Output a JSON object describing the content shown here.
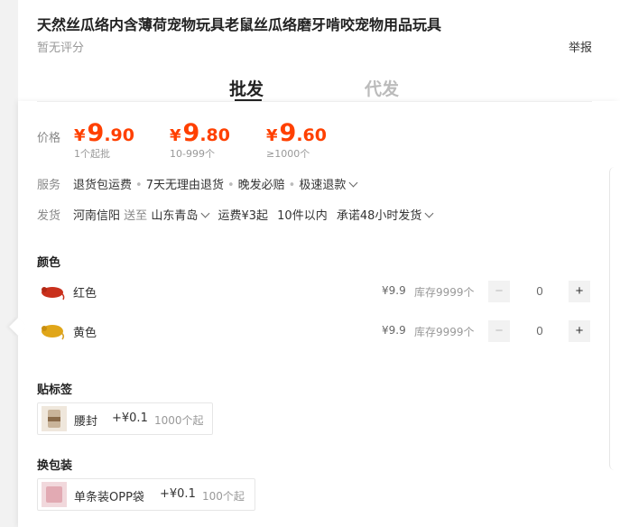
{
  "product": {
    "title": "天然丝瓜络内含薄荷宠物玩具老鼠丝瓜络磨牙啃咬宠物用品玩具",
    "rating": "暂无评分",
    "report": "举报"
  },
  "tabs": [
    {
      "label": "批发",
      "active": true
    },
    {
      "label": "代发",
      "active": false
    }
  ],
  "price": {
    "label": "价格",
    "currency": "¥",
    "tiers": [
      {
        "int": "9",
        "dec": ".90",
        "range": "1个起批"
      },
      {
        "int": "9",
        "dec": ".80",
        "range": "10-999个"
      },
      {
        "int": "9",
        "dec": ".60",
        "range": "≥1000个"
      }
    ]
  },
  "service": {
    "label": "服务",
    "items": [
      "退货包运费",
      "7天无理由退货",
      "晚发必赔",
      "极速退款"
    ]
  },
  "shipping": {
    "label": "发货",
    "from": "河南信阳",
    "to_word": "送至",
    "to": "山东青岛",
    "fee": "运费¥3起",
    "qty_note": "10件以内",
    "promise": "承诺48小时发货"
  },
  "color": {
    "title": "颜色",
    "items": [
      {
        "name": "红色",
        "price": "¥9.9",
        "stock": "库存9999个",
        "qty": "0",
        "swatch": "#c9301c"
      },
      {
        "name": "黄色",
        "price": "¥9.9",
        "stock": "库存9999个",
        "qty": "0",
        "swatch": "#e0a619"
      }
    ]
  },
  "label_option": {
    "title": "贴标签",
    "name": "腰封",
    "price": "+¥0.1",
    "min": "1000个起"
  },
  "package_option": {
    "title": "换包装",
    "name": "单条装OPP袋",
    "price": "+¥0.1",
    "min": "100个起"
  },
  "buttons": {
    "minus": "−",
    "plus": "+"
  },
  "colors": {
    "accent": "#ff4000"
  }
}
